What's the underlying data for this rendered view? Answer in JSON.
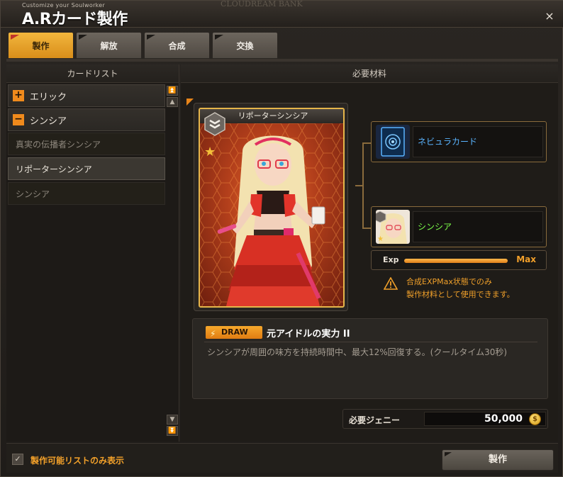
{
  "window": {
    "subtitle": "Customize your Soulworker",
    "title": "A.Rカード製作",
    "background_text": "CLOUDREAM BANK",
    "close_label": "×"
  },
  "tabs": [
    {
      "label": "製作",
      "active": true
    },
    {
      "label": "解放",
      "active": false
    },
    {
      "label": "合成",
      "active": false
    },
    {
      "label": "交換",
      "active": false
    }
  ],
  "card_list": {
    "header": "カードリスト",
    "groups": [
      {
        "toggle": "+",
        "label": "エリック",
        "expanded": false
      },
      {
        "toggle": "−",
        "label": "シンシア",
        "expanded": true
      }
    ],
    "cards": [
      {
        "label": "真実の伝播者シンシア",
        "selected": false
      },
      {
        "label": "リポーターシンシア",
        "selected": true
      },
      {
        "label": "シンシア",
        "selected": false
      }
    ]
  },
  "materials": {
    "header": "必要材料",
    "card": {
      "name": "リポーターシンシア",
      "rank_icon": "chevron-rank-icon",
      "star_icon": "star-icon"
    },
    "items": [
      {
        "name": "ネビュラカード",
        "color": "#5ab4ff",
        "icon": "nebula-card-icon"
      },
      {
        "name": "シンシア",
        "color": "#7dff4a",
        "icon": "cynthia-portrait-icon"
      }
    ],
    "exp": {
      "label": "Exp",
      "max_label": "Max",
      "progress": 1.0
    },
    "warning": {
      "line1": "合成EXPMax状態でのみ",
      "line2": "製作材料として使用できます。"
    }
  },
  "skill": {
    "badge": "DRAW",
    "name": "元アイドルの実力 II",
    "description": "シンシアが周囲の味方を持続時間中、最大12%回復する。(クールタイム30秒)"
  },
  "cost": {
    "label": "必要ジェニー",
    "value": "50,000",
    "coin_symbol": "$"
  },
  "bottom": {
    "checkbox_checked": true,
    "checkbox_label": "製作可能リストのみ表示",
    "craft_button": "製作"
  },
  "colors": {
    "accent_orange": "#f08a1c",
    "gold_border": "#e5b54a",
    "warning_text": "#f0a02a"
  }
}
